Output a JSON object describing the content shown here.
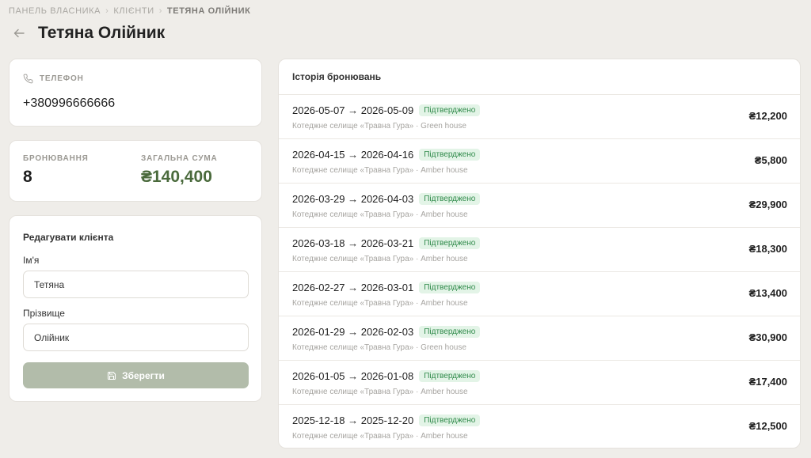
{
  "breadcrumb": {
    "items": [
      "ПАНЕЛЬ ВЛАСНИКА",
      "КЛІЄНТИ"
    ],
    "separator": "›",
    "current": "ТЕТЯНА ОЛІЙНИК"
  },
  "header": {
    "title": "Тетяна Олійник"
  },
  "phone": {
    "label": "ТЕЛЕФОН",
    "value": "+380996666666"
  },
  "stats": {
    "bookings_label": "БРОНЮВАННЯ",
    "bookings_value": "8",
    "total_label": "ЗАГАЛЬНА СУМА",
    "total_value": "₴140,400"
  },
  "edit": {
    "title": "Редагувати клієнта",
    "first_name_label": "Ім'я",
    "first_name_value": "Тетяна",
    "last_name_label": "Прізвище",
    "last_name_value": "Олійник",
    "save_label": "Зберегти"
  },
  "history": {
    "title": "Історія бронювань",
    "rows": [
      {
        "dates": "2026-05-07 → 2026-05-09",
        "status": "Підтверджено",
        "location": "Котеджне селище «Травна Гура» · Green house",
        "amount": "₴12,200"
      },
      {
        "dates": "2026-04-15 → 2026-04-16",
        "status": "Підтверджено",
        "location": "Котеджне селище «Травна Гура» · Amber house",
        "amount": "₴5,800"
      },
      {
        "dates": "2026-03-29 → 2026-04-03",
        "status": "Підтверджено",
        "location": "Котеджне селище «Травна Гура» · Amber house",
        "amount": "₴29,900"
      },
      {
        "dates": "2026-03-18 → 2026-03-21",
        "status": "Підтверджено",
        "location": "Котеджне селище «Травна Гура» · Amber house",
        "amount": "₴18,300"
      },
      {
        "dates": "2026-02-27 → 2026-03-01",
        "status": "Підтверджено",
        "location": "Котеджне селище «Травна Гура» · Amber house",
        "amount": "₴13,400"
      },
      {
        "dates": "2026-01-29 → 2026-02-03",
        "status": "Підтверджено",
        "location": "Котеджне селище «Травна Гура» · Green house",
        "amount": "₴30,900"
      },
      {
        "dates": "2026-01-05 → 2026-01-08",
        "status": "Підтверджено",
        "location": "Котеджне селище «Травна Гура» · Amber house",
        "amount": "₴17,400"
      },
      {
        "dates": "2025-12-18 → 2025-12-20",
        "status": "Підтверджено",
        "location": "Котеджне селище «Травна Гура» · Amber house",
        "amount": "₴12,500"
      }
    ]
  },
  "colors": {
    "background": "#efede9",
    "accent_green": "#4a6a3c",
    "badge_bg": "#e3f4e7",
    "badge_text": "#2f8a4a",
    "save_button": "#b2bcaa"
  },
  "icons": {
    "back": "arrow-left-icon",
    "phone": "phone-icon",
    "save": "save-icon"
  }
}
